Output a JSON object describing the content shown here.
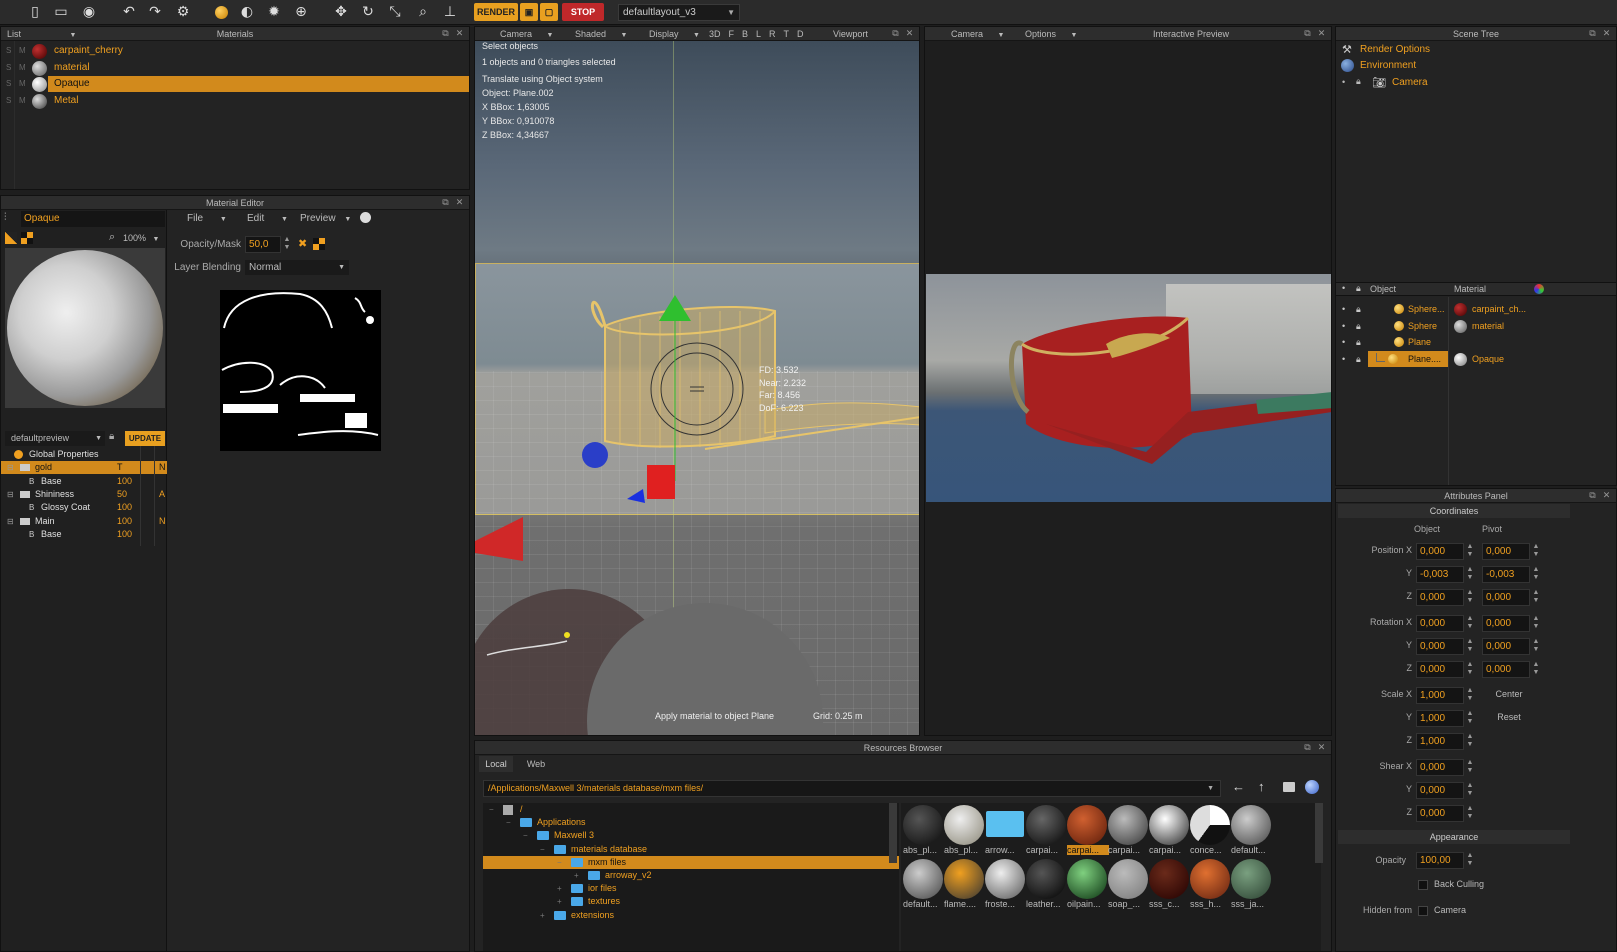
{
  "toolbar": {
    "render_label": "RENDER",
    "stop_label": "STOP",
    "layout_value": "defaultlayout_v3"
  },
  "materials_panel": {
    "list_label": "List",
    "title": "Materials",
    "items": [
      {
        "s": "S",
        "m": "M",
        "name": "carpaint_cherry"
      },
      {
        "s": "S",
        "m": "M",
        "name": "material"
      },
      {
        "s": "S",
        "m": "M",
        "name": "Opaque"
      },
      {
        "s": "S",
        "m": "M",
        "name": "Metal"
      }
    ]
  },
  "material_editor": {
    "title": "Material Editor",
    "name_value": "Opaque",
    "zoom": "100%",
    "menus": [
      "File",
      "Edit",
      "Preview"
    ],
    "opacity_label": "Opacity/Mask",
    "opacity_value": "50,0",
    "blending_label": "Layer Blending",
    "blending_value": "Normal",
    "preview_scene": "defaultpreview",
    "update_label": "UPDATE",
    "layers": [
      {
        "name": "Global Properties",
        "v": "",
        "f": ""
      },
      {
        "name": "gold",
        "v": "T",
        "f": "N"
      },
      {
        "name": "Base",
        "v": "100",
        "f": "",
        "prefix": "B"
      },
      {
        "name": "Shininess",
        "v": "50",
        "f": "A"
      },
      {
        "name": "Glossy Coat",
        "v": "100",
        "f": "",
        "prefix": "B"
      },
      {
        "name": "Main",
        "v": "100",
        "f": "N"
      },
      {
        "name": "Base",
        "v": "100",
        "f": "",
        "prefix": "B"
      }
    ]
  },
  "viewport": {
    "title": "Viewport",
    "menus": [
      "Camera",
      "Shaded",
      "Display"
    ],
    "views": [
      "3D",
      "F",
      "B",
      "L",
      "R",
      "T",
      "D"
    ],
    "info": [
      "Select objects",
      "1 objects and 0 triangles selected",
      "Translate using Object system",
      "Object: Plane.002",
      "X BBox: 1,63005",
      "Y BBox: 0,910078",
      "Z BBox: 4,34667"
    ],
    "camera_info": [
      "FD: 3.532",
      "Near: 2.232",
      "Far: 8.456",
      "DoF: 6.223"
    ],
    "status_left": "Apply material to object Plane",
    "status_right": "Grid: 0.25 m"
  },
  "interactive_preview": {
    "title": "Interactive Preview",
    "menus": [
      "Camera",
      "Options"
    ]
  },
  "scene_tree": {
    "title": "Scene Tree",
    "top_items": [
      "Render Options",
      "Environment",
      "Camera"
    ],
    "col_object": "Object",
    "col_material": "Material",
    "rows": [
      {
        "object": "Sphere...",
        "material": "carpaint_ch..."
      },
      {
        "object": "Sphere",
        "material": "material"
      },
      {
        "object": "Plane",
        "material": ""
      },
      {
        "object": "Plane....",
        "material": "Opaque"
      }
    ]
  },
  "attributes": {
    "title": "Attributes Panel",
    "coordinates": "Coordinates",
    "col_object": "Object",
    "col_pivot": "Pivot",
    "rows": [
      {
        "label": "Position X",
        "obj": "0,000",
        "piv": "0,000"
      },
      {
        "label": "Y",
        "obj": "-0,003",
        "piv": "-0,003"
      },
      {
        "label": "Z",
        "obj": "0,000",
        "piv": "0,000"
      },
      {
        "label": "Rotation X",
        "obj": "0,000",
        "piv": "0,000"
      },
      {
        "label": "Y",
        "obj": "0,000",
        "piv": "0,000"
      },
      {
        "label": "Z",
        "obj": "0,000",
        "piv": "0,000"
      },
      {
        "label": "Scale X",
        "obj": "1,000",
        "piv": ""
      },
      {
        "label": "Y",
        "obj": "1,000",
        "piv": ""
      },
      {
        "label": "Z",
        "obj": "1,000",
        "piv": ""
      },
      {
        "label": "Shear X",
        "obj": "0,000",
        "piv": ""
      },
      {
        "label": "Y",
        "obj": "0,000",
        "piv": ""
      },
      {
        "label": "Z",
        "obj": "0,000",
        "piv": ""
      }
    ],
    "center_label": "Center",
    "reset_label": "Reset",
    "appearance": "Appearance",
    "opacity_label": "Opacity",
    "opacity_value": "100,00",
    "back_culling": "Back Culling",
    "hidden_from_label": "Hidden from",
    "hidden_from_value": "Camera"
  },
  "resources": {
    "title": "Resources Browser",
    "tabs": [
      "Local",
      "Web"
    ],
    "path": "/Applications/Maxwell 3/materials database/mxm files/",
    "tree": [
      {
        "name": "/",
        "depth": 0
      },
      {
        "name": "Applications",
        "depth": 1
      },
      {
        "name": "Maxwell 3",
        "depth": 2
      },
      {
        "name": "materials database",
        "depth": 3
      },
      {
        "name": "mxm files",
        "depth": 4
      },
      {
        "name": "arroway_v2",
        "depth": 5
      },
      {
        "name": "ior files",
        "depth": 4
      },
      {
        "name": "textures",
        "depth": 4
      },
      {
        "name": "extensions",
        "depth": 3
      }
    ],
    "thumbs_row1": [
      "abs_pl...",
      "abs_pl...",
      "arrow...",
      "carpai...",
      "carpai...",
      "carpai...",
      "carpai...",
      "conce...",
      "default..."
    ],
    "thumbs_row2": [
      "default...",
      "flame....",
      "froste...",
      "leather...",
      "oilpain...",
      "soap_...",
      "sss_c...",
      "sss_h...",
      "sss_ja..."
    ]
  }
}
